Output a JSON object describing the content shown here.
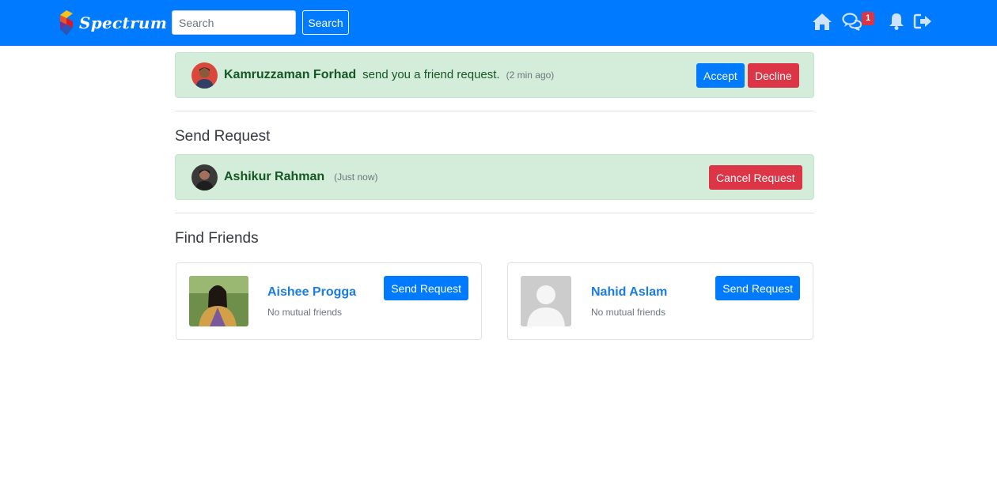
{
  "navbar": {
    "brand": "Spectrum",
    "search_placeholder": "Search",
    "search_button": "Search",
    "icons": [
      "home-icon",
      "chat-icon",
      "bell-icon",
      "logout-icon"
    ],
    "chat_badge": "1"
  },
  "incoming_request": {
    "name": "Kamruzzaman Forhad",
    "message": "send you a friend request.",
    "time": "(2 min ago)",
    "accept_label": "Accept",
    "decline_label": "Decline"
  },
  "sent_section": {
    "title": "Send Request",
    "request": {
      "name": "Ashikur Rahman",
      "time": "(Just now)",
      "cancel_label": "Cancel Request"
    }
  },
  "find_section": {
    "title": "Find Friends",
    "people": [
      {
        "name": "Aishee Progga",
        "subtitle": "No mutual friends",
        "button": "Send Request"
      },
      {
        "name": "Nahid Aslam",
        "subtitle": "No mutual friends",
        "button": "Send Request"
      }
    ]
  },
  "colors": {
    "primary": "#007bff",
    "danger": "#dc3545",
    "success_bg": "#d4edda",
    "success_text": "#155724"
  }
}
